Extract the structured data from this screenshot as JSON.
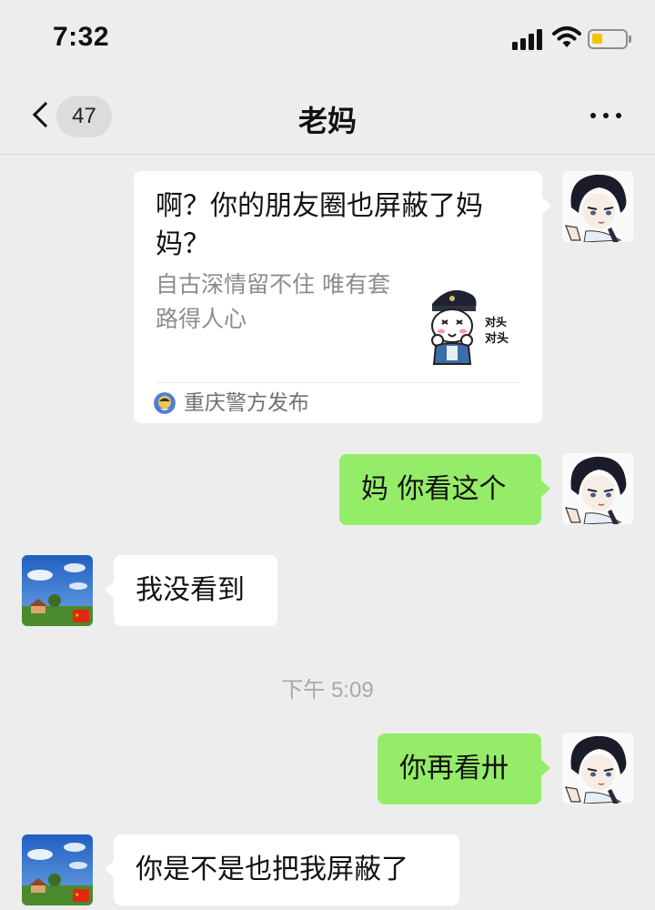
{
  "status_bar": {
    "time": "7:32"
  },
  "nav": {
    "unread_count": "47",
    "title": "老妈"
  },
  "messages": {
    "card": {
      "title": "啊？你的朋友圈也屏蔽了妈妈？",
      "description": "自古深情留不住 唯有套路得人心",
      "sticker_text": "对头\n对头",
      "source": "重庆警方发布"
    },
    "m1": "妈 你看这个",
    "m2": "我没看到",
    "timestamp": "下午 5:09",
    "m3": "你再看卅",
    "m4": "你是不是也把我屏蔽了"
  },
  "colors": {
    "background": "#ededed",
    "bubble_green": "#95ec69",
    "bubble_white": "#ffffff",
    "battery": "#f5c400"
  },
  "icons": [
    "signal-icon",
    "wifi-icon",
    "battery-icon",
    "back-chevron-icon",
    "more-icon",
    "avatar"
  ]
}
